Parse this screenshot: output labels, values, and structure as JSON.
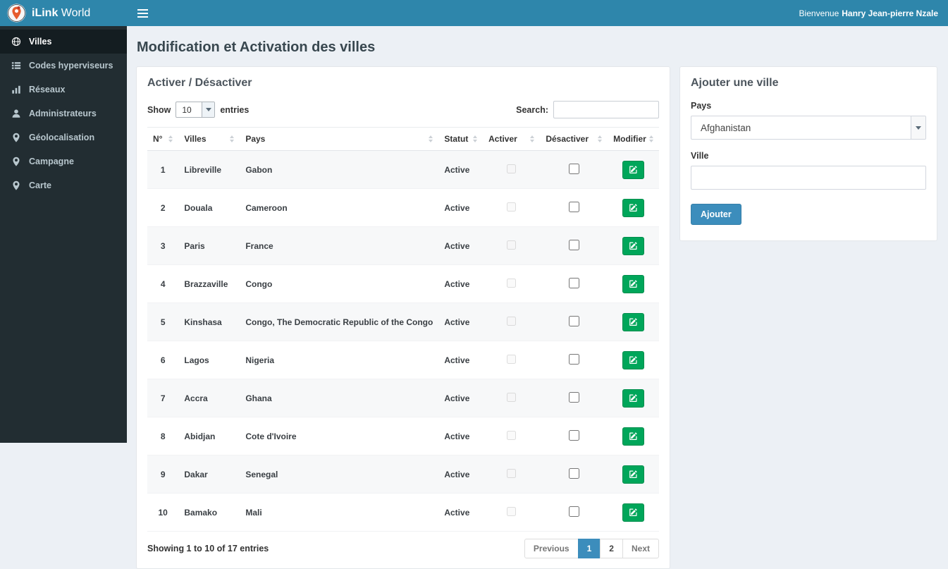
{
  "colors": {
    "navbar_bg": "#2e86ab",
    "sidebar_bg": "#222d32",
    "sidebar_active_bg": "#141d21",
    "sidebar_text": "#b8c7ce",
    "content_bg": "#ecf0f5",
    "accent_blue": "#3c8dbc",
    "accent_blue_border": "#367fa9",
    "success_green": "#00a65a",
    "success_green_border": "#008d4c"
  },
  "navbar": {
    "brand_bold": "iLink",
    "brand_rest": "World",
    "welcome_prefix": "Bienvenue",
    "welcome_name": "Hanry Jean-pierre Nzale"
  },
  "sidebar": {
    "items": [
      {
        "label": "Villes",
        "icon": "globe"
      },
      {
        "label": "Codes hyperviseurs",
        "icon": "list"
      },
      {
        "label": "Réseaux",
        "icon": "bar-chart"
      },
      {
        "label": "Administrateurs",
        "icon": "user"
      },
      {
        "label": "Géolocalisation",
        "icon": "map-marker"
      },
      {
        "label": "Campagne",
        "icon": "map-marker"
      },
      {
        "label": "Carte",
        "icon": "map-marker"
      }
    ]
  },
  "page": {
    "title": "Modification et Activation des villes"
  },
  "table_panel": {
    "title": "Activer / Désactiver",
    "show_label": "Show",
    "page_length": "10",
    "entries_label": "entries",
    "search_label": "Search:",
    "search_value": "",
    "columns": [
      "N°",
      "Villes",
      "Pays",
      "Statut",
      "Activer",
      "Désactiver",
      "Modifier"
    ],
    "rows": [
      {
        "num": "1",
        "ville": "Libreville",
        "pays": "Gabon",
        "statut": "Active"
      },
      {
        "num": "2",
        "ville": "Douala",
        "pays": "Cameroon",
        "statut": "Active"
      },
      {
        "num": "3",
        "ville": "Paris",
        "pays": "France",
        "statut": "Active"
      },
      {
        "num": "4",
        "ville": "Brazzaville",
        "pays": "Congo",
        "statut": "Active"
      },
      {
        "num": "5",
        "ville": "Kinshasa",
        "pays": "Congo, The Democratic Republic of the Congo",
        "statut": "Active"
      },
      {
        "num": "6",
        "ville": "Lagos",
        "pays": "Nigeria",
        "statut": "Active"
      },
      {
        "num": "7",
        "ville": "Accra",
        "pays": "Ghana",
        "statut": "Active"
      },
      {
        "num": "8",
        "ville": "Abidjan",
        "pays": "Cote d'Ivoire",
        "statut": "Active"
      },
      {
        "num": "9",
        "ville": "Dakar",
        "pays": "Senegal",
        "statut": "Active"
      },
      {
        "num": "10",
        "ville": "Bamako",
        "pays": "Mali",
        "statut": "Active"
      }
    ],
    "footer": {
      "info": "Showing 1 to 10 of 17 entries",
      "previous": "Previous",
      "pages": [
        "1",
        "2"
      ],
      "active_page": "1",
      "next": "Next"
    }
  },
  "add_panel": {
    "title": "Ajouter une ville",
    "pays_label": "Pays",
    "pays_value": "Afghanistan",
    "ville_label": "Ville",
    "ville_value": "",
    "submit_label": "Ajouter"
  }
}
